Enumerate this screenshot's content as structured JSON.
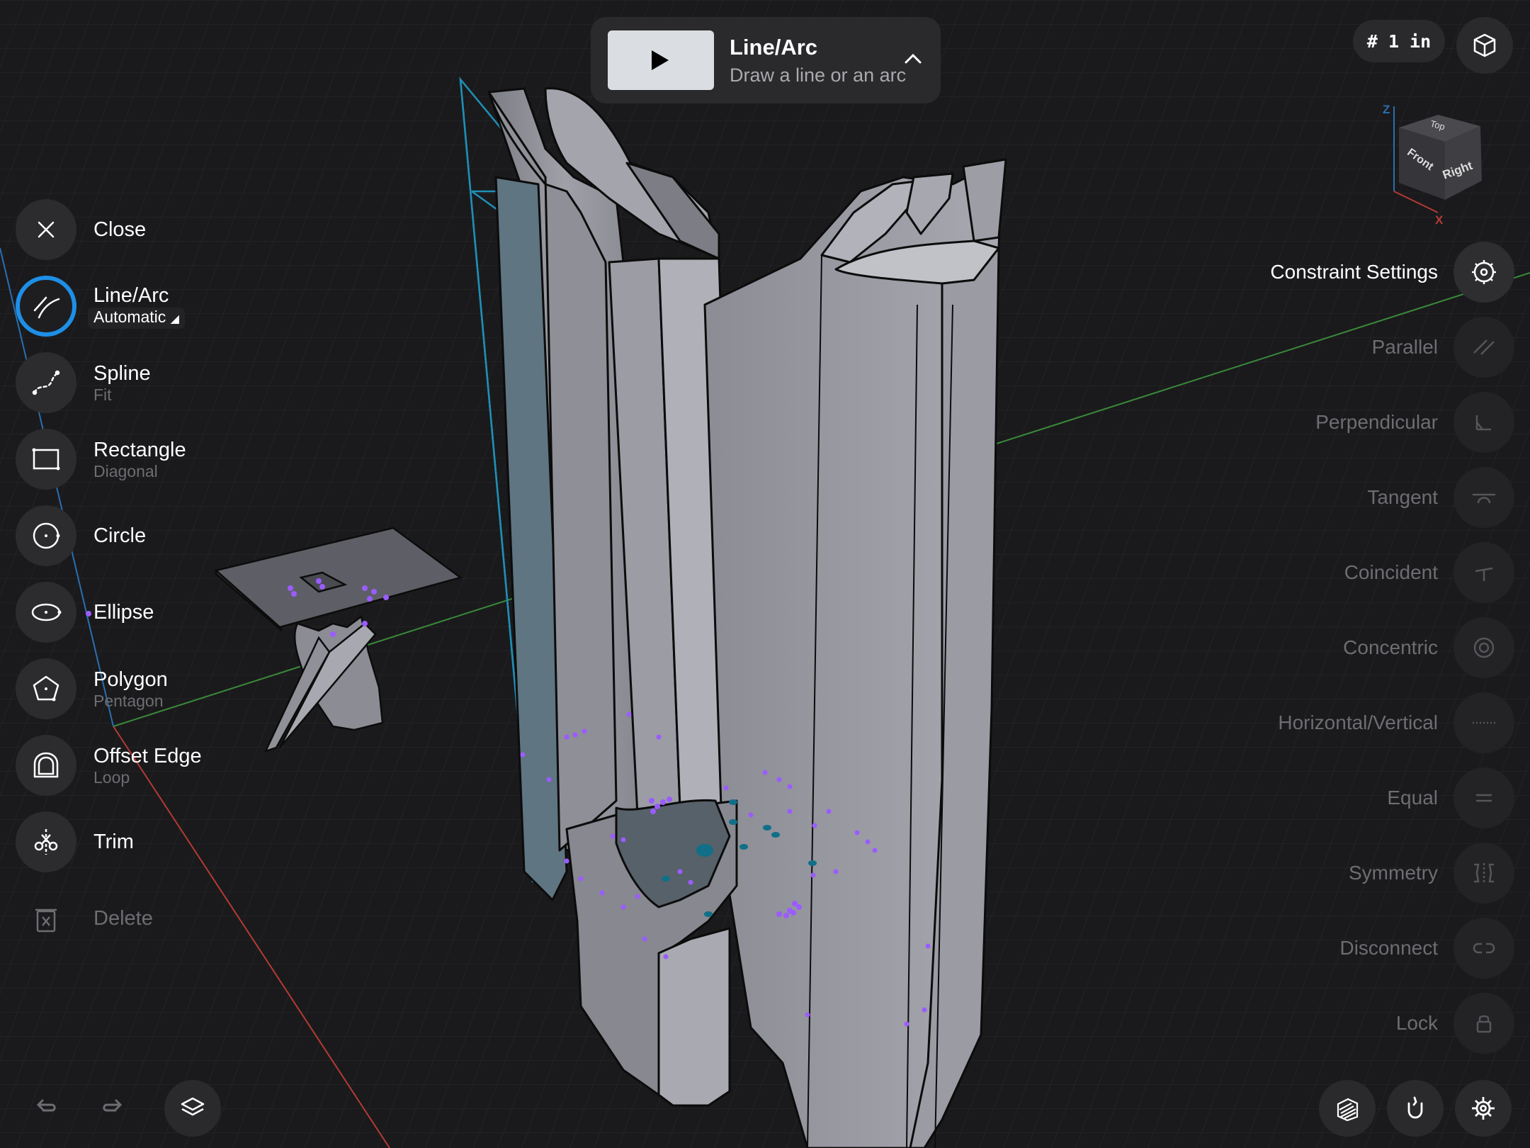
{
  "app": {
    "accent": "#1e8fe6",
    "background": "#1a1a1c"
  },
  "toolbar_card": {
    "title": "Line/Arc",
    "subtitle": "Draw a line or an arc",
    "thumbnail_icon": "play-icon",
    "collapse_icon": "chevron-up-icon"
  },
  "top_right": {
    "grid_label": "# 1 in",
    "view_icon": "cube-icon"
  },
  "view_cube": {
    "axis_z": "Z",
    "axis_x": "X",
    "face_top": "Top",
    "face_front": "Front",
    "face_right": "Right"
  },
  "tools": [
    {
      "label": "Close",
      "sub": "",
      "icon": "close-icon"
    },
    {
      "label": "Line/Arc",
      "sub": "Automatic",
      "icon": "line-arc-icon",
      "active": true
    },
    {
      "label": "Spline",
      "sub": "Fit",
      "icon": "spline-icon"
    },
    {
      "label": "Rectangle",
      "sub": "Diagonal",
      "icon": "rectangle-icon"
    },
    {
      "label": "Circle",
      "sub": "",
      "icon": "circle-icon"
    },
    {
      "label": "Ellipse",
      "sub": "",
      "icon": "ellipse-icon"
    },
    {
      "label": "Polygon",
      "sub": "Pentagon",
      "icon": "polygon-icon"
    },
    {
      "label": "Offset Edge",
      "sub": "Loop",
      "icon": "offset-edge-icon"
    },
    {
      "label": "Trim",
      "sub": "",
      "icon": "trim-icon"
    },
    {
      "label": "Delete",
      "sub": "",
      "icon": "trash-icon",
      "disabled": true
    }
  ],
  "constraints": [
    {
      "label": "Constraint Settings",
      "icon": "gear-icon",
      "active": true
    },
    {
      "label": "Parallel",
      "icon": "parallel-icon"
    },
    {
      "label": "Perpendicular",
      "icon": "perpendicular-icon"
    },
    {
      "label": "Tangent",
      "icon": "tangent-icon"
    },
    {
      "label": "Coincident",
      "icon": "coincident-icon"
    },
    {
      "label": "Concentric",
      "icon": "concentric-icon"
    },
    {
      "label": "Horizontal/Vertical",
      "icon": "horizontal-vertical-icon"
    },
    {
      "label": "Equal",
      "icon": "equal-icon"
    },
    {
      "label": "Symmetry",
      "icon": "symmetry-icon"
    },
    {
      "label": "Disconnect",
      "icon": "disconnect-icon"
    },
    {
      "label": "Lock",
      "icon": "lock-icon"
    }
  ],
  "bottom_left": [
    "undo-icon",
    "redo-icon",
    "layers-icon"
  ],
  "bottom_right": [
    "section-view-icon",
    "snap-magnet-icon",
    "settings-gear-icon"
  ]
}
